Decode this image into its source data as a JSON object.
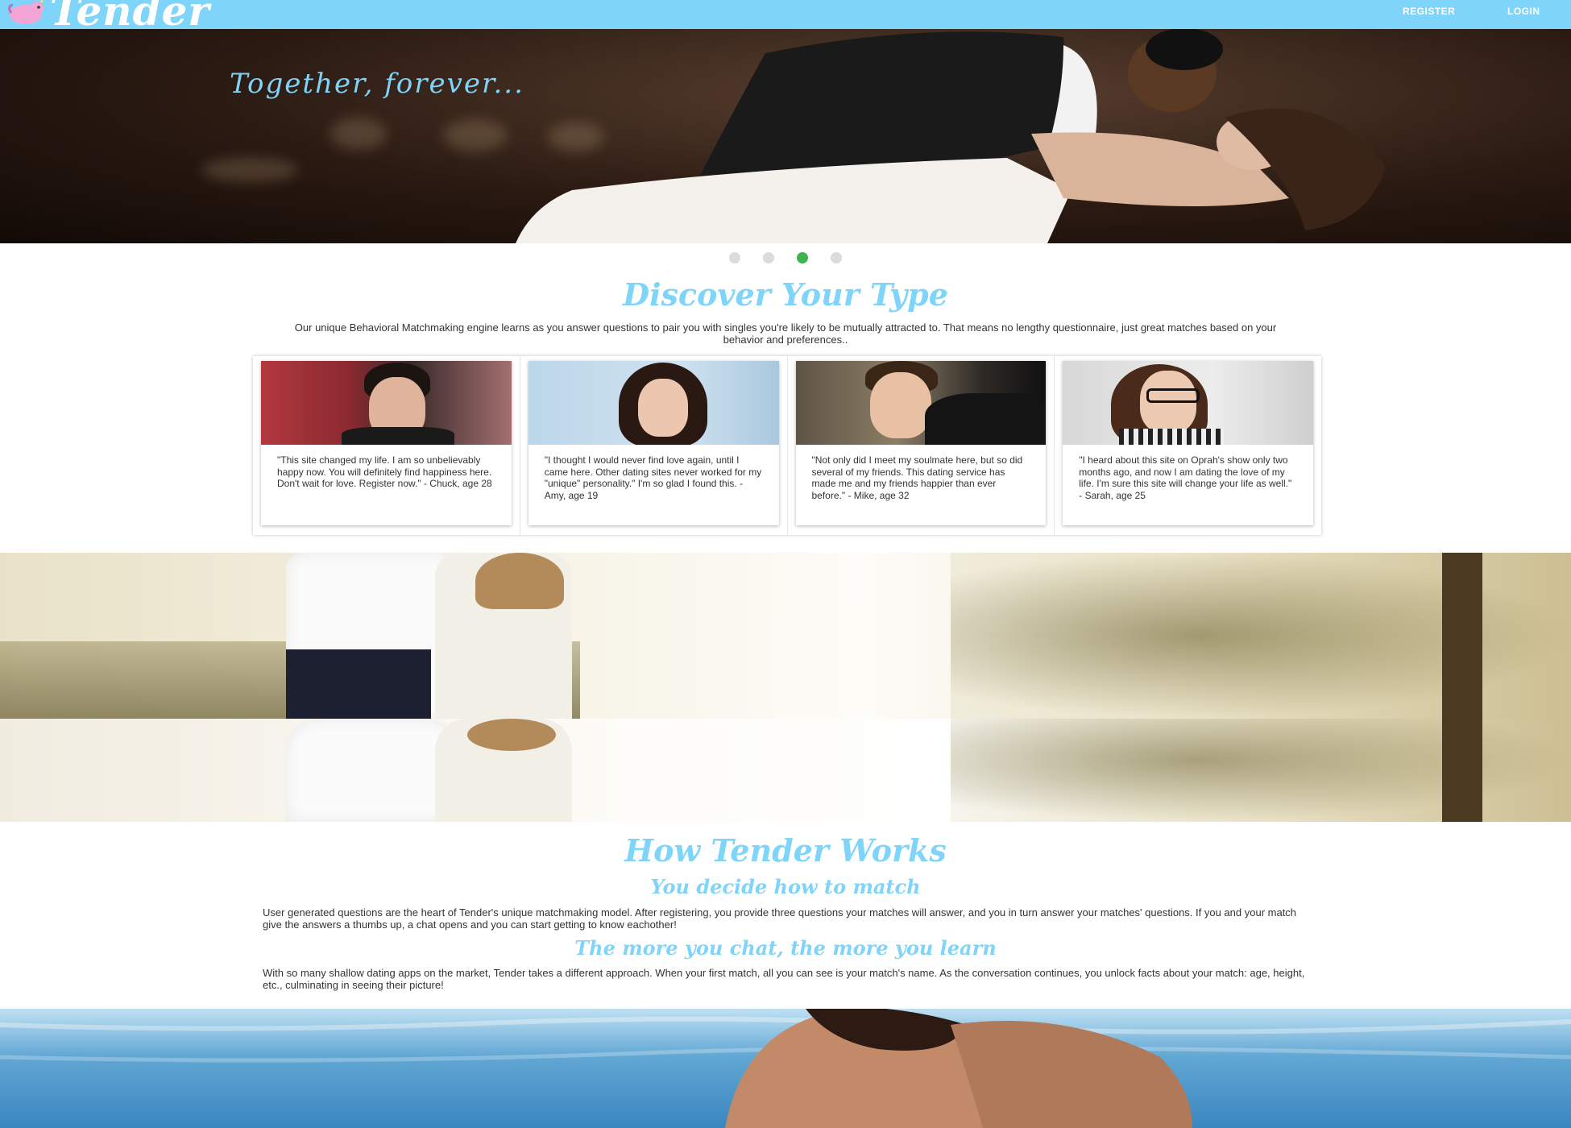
{
  "nav": {
    "brand": "Tender",
    "links": {
      "register": "REGISTER",
      "login": "LOGIN"
    }
  },
  "hero": {
    "caption": "Together, forever...",
    "slides": 4,
    "active_slide": 3
  },
  "discover": {
    "title": "Discover Your Type",
    "intro": "Our unique Behavioral Matchmaking engine learns as you answer questions to pair you with singles you're likely to be mutually attracted to. That means no lengthy questionnaire, just great matches based on your behavior and preferences..",
    "testimonials": [
      {
        "quote": "\"This site changed my life. I am so unbelievably happy now. You will definitely find happiness here. Don't wait for love. Register now.\" - Chuck, age 28"
      },
      {
        "quote": "\"I thought I would never find love again, until I came here. Other dating sites never worked for my \"unique\" personality.\" I'm so glad I found this. - Amy, age 19"
      },
      {
        "quote": "\"Not only did I meet my soulmate here, but so did several of my friends. This dating service has made me and my friends happier than ever before.\" - Mike, age 32"
      },
      {
        "quote": "\"I heard about this site on Oprah's show only two months ago, and now I am dating the love of my life. I'm sure this site will change your life as well.\" - Sarah, age 25"
      }
    ]
  },
  "how": {
    "title": "How Tender Works",
    "sub1": "You decide how to match",
    "text1": "User generated questions are the heart of Tender's unique matchmaking model. After registering, you provide three questions your matches will answer, and you in turn answer your matches' questions. If you and your match give the answers a thumbs up, a chat opens and you can start getting to know eachother!",
    "sub2": "The more you chat, the more you learn",
    "text2": "With so many shallow dating apps on the market, Tender takes a different approach. When your first match, all you can see is your match's name. As the conversation continues, you unlock facts about your match: age, height, etc., culminating in seeing their picture!"
  },
  "colors": {
    "nav": "#7fd4f9",
    "accent": "#7fd4f9",
    "active_dot": "#3fb34f"
  }
}
